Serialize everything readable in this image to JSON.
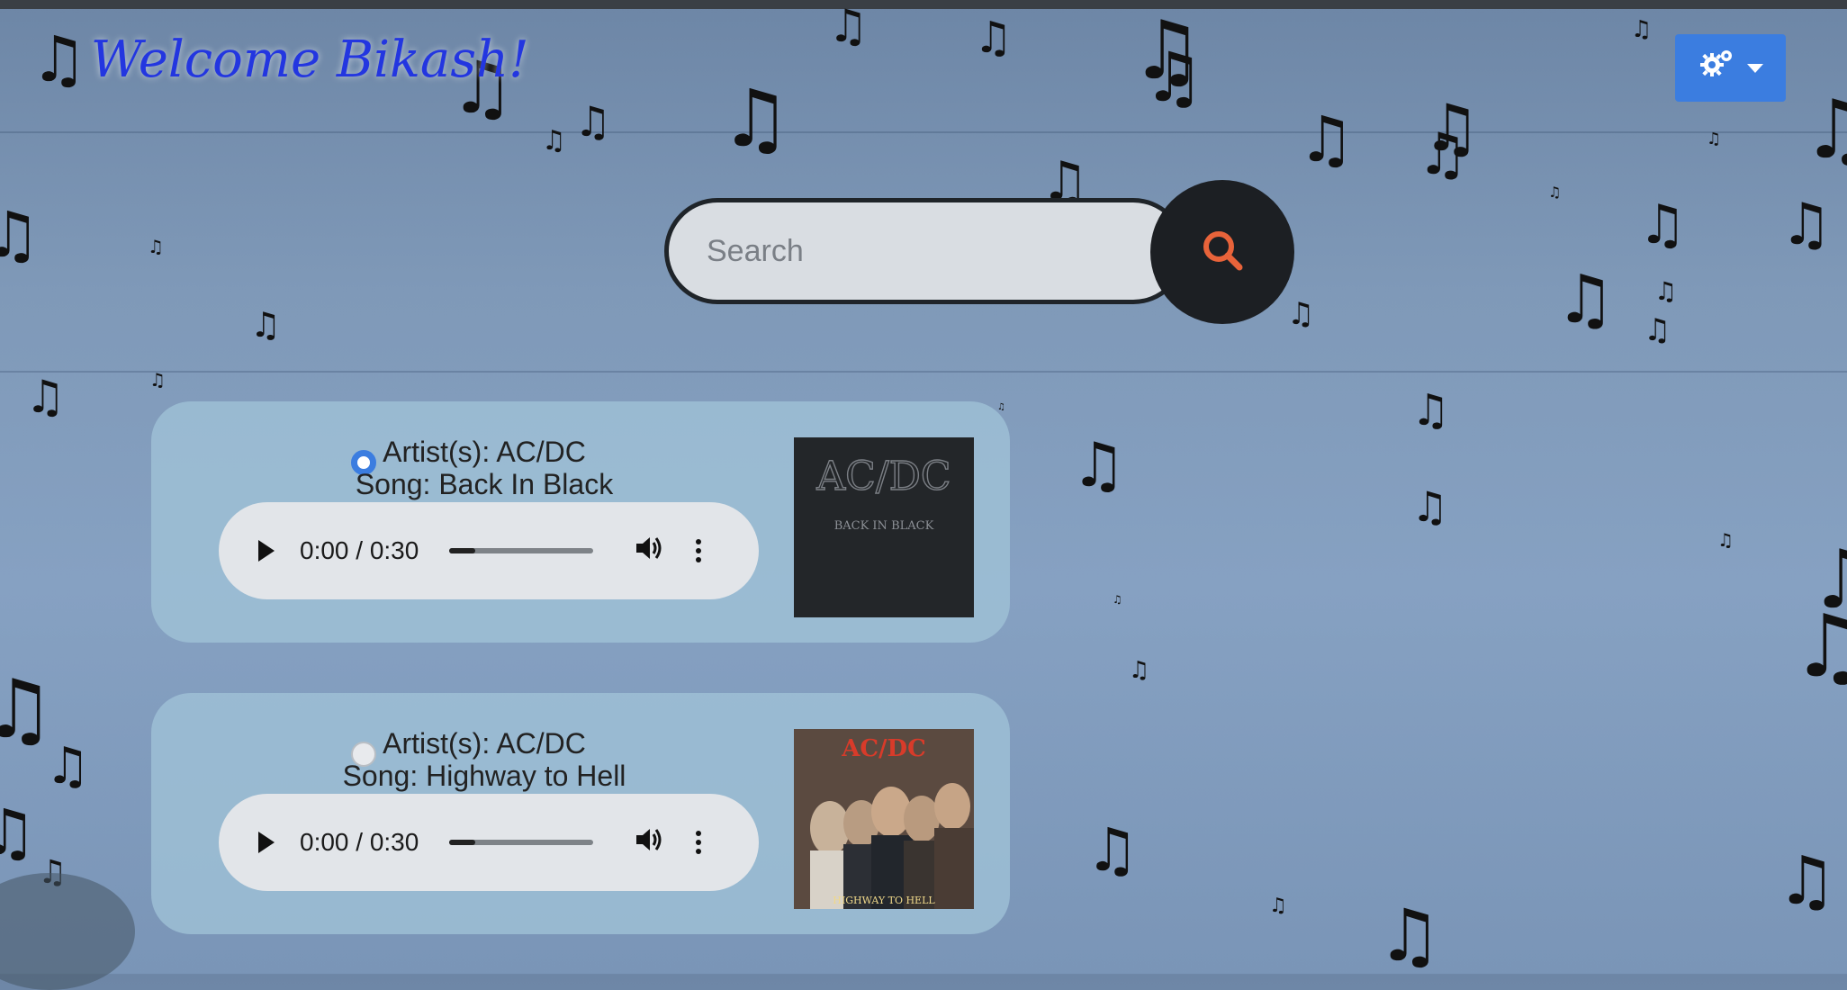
{
  "header": {
    "welcome_text": "Welcome Bikash!",
    "note_glyph": "♫"
  },
  "settings": {
    "icon": "gears-icon",
    "dropdown_icon": "caret-down-icon",
    "accent": "#3b7de0"
  },
  "search": {
    "placeholder": "Search",
    "value": "",
    "icon": "search-icon",
    "icon_color": "#e8633a"
  },
  "songs": [
    {
      "artist": "Artist(s): AC/DC",
      "song": "Song: Back In Black",
      "selected": true,
      "time": "0:00 / 0:30",
      "progress": 0.18,
      "cover": {
        "band": "AC/DC",
        "title": "BACK IN BLACK"
      }
    },
    {
      "artist": "Artist(s): AC/DC",
      "song": "Song: Highway to Hell",
      "selected": false,
      "time": "0:00 / 0:30",
      "progress": 0.18,
      "cover": {
        "band": "AC/DC",
        "title": "HIGHWAY TO HELL"
      }
    }
  ]
}
